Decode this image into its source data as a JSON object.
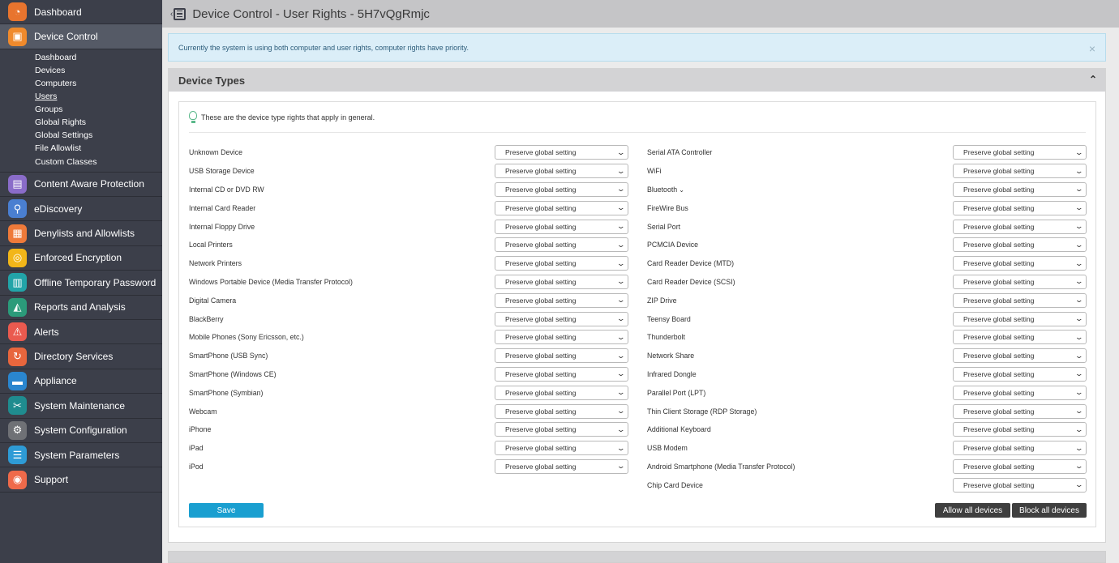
{
  "sidebar": {
    "items": [
      {
        "id": "dashboard",
        "label": "Dashboard",
        "icon": "dashboard-icon",
        "color": "#e8742e",
        "glyph": "◔"
      },
      {
        "id": "device-control",
        "label": "Device Control",
        "icon": "device-control-icon",
        "color": "#f08a2c",
        "glyph": "▣"
      },
      {
        "id": "content-aware",
        "label": "Content Aware Protection",
        "icon": "content-aware-icon",
        "color": "#8a6cc9",
        "glyph": "▤"
      },
      {
        "id": "ediscovery",
        "label": "eDiscovery",
        "icon": "ediscovery-icon",
        "color": "#4a7fd1",
        "glyph": "⚲"
      },
      {
        "id": "denylists",
        "label": "Denylists and Allowlists",
        "icon": "denylists-icon",
        "color": "#ef7a3a",
        "glyph": "▦"
      },
      {
        "id": "encryption",
        "label": "Enforced Encryption",
        "icon": "encryption-icon",
        "color": "#f2b619",
        "glyph": "◎"
      },
      {
        "id": "otp",
        "label": "Offline Temporary Password",
        "icon": "otp-icon",
        "color": "#22a4a8",
        "glyph": "▥"
      },
      {
        "id": "reports",
        "label": "Reports and Analysis",
        "icon": "reports-icon",
        "color": "#2b9b7a",
        "glyph": "◭"
      },
      {
        "id": "alerts",
        "label": "Alerts",
        "icon": "alerts-icon",
        "color": "#ea5a4f",
        "glyph": "⚠"
      },
      {
        "id": "directory",
        "label": "Directory Services",
        "icon": "directory-icon",
        "color": "#e8663d",
        "glyph": "↻"
      },
      {
        "id": "appliance",
        "label": "Appliance",
        "icon": "appliance-icon",
        "color": "#2a86cf",
        "glyph": "▬"
      },
      {
        "id": "maintenance",
        "label": "System Maintenance",
        "icon": "maintenance-icon",
        "color": "#1f8c8f",
        "glyph": "✂"
      },
      {
        "id": "configuration",
        "label": "System Configuration",
        "icon": "configuration-icon",
        "color": "#6f7176",
        "glyph": "⚙"
      },
      {
        "id": "parameters",
        "label": "System Parameters",
        "icon": "parameters-icon",
        "color": "#2e9bd6",
        "glyph": "☰"
      },
      {
        "id": "support",
        "label": "Support",
        "icon": "support-icon",
        "color": "#ef6a4a",
        "glyph": "◉"
      }
    ],
    "submenu": [
      {
        "label": "Dashboard",
        "current": false
      },
      {
        "label": "Devices",
        "current": false
      },
      {
        "label": "Computers",
        "current": false
      },
      {
        "label": "Users",
        "current": true
      },
      {
        "label": "Groups",
        "current": false
      },
      {
        "label": "Global Rights",
        "current": false
      },
      {
        "label": "Global Settings",
        "current": false
      },
      {
        "label": "File Allowlist",
        "current": false
      },
      {
        "label": "Custom Classes",
        "current": false
      }
    ]
  },
  "header": {
    "title": "Device Control - User Rights - 5H7vQgRmjc"
  },
  "alert": {
    "text": "Currently the system is using both computer and user rights, computer rights have priority.",
    "close": "×"
  },
  "panel": {
    "title": "Device Types",
    "toggle": "⌃",
    "hint": "These are the device type rights that apply in general.",
    "select_value": "Preserve global setting",
    "left_devices": [
      "Unknown Device",
      "USB Storage Device",
      "Internal CD or DVD RW",
      "Internal Card Reader",
      "Internal Floppy Drive",
      "Local Printers",
      "Network Printers",
      "Windows Portable Device (Media Transfer Protocol)",
      "Digital Camera",
      "BlackBerry",
      "Mobile Phones (Sony Ericsson, etc.)",
      "SmartPhone (USB Sync)",
      "SmartPhone (Windows CE)",
      "SmartPhone (Symbian)",
      "Webcam",
      "iPhone",
      "iPad",
      "iPod"
    ],
    "right_devices": [
      "Serial ATA Controller",
      "WiFi",
      "Bluetooth",
      "FireWire Bus",
      "Serial Port",
      "PCMCIA Device",
      "Card Reader Device (MTD)",
      "Card Reader Device (SCSI)",
      "ZIP Drive",
      "Teensy Board",
      "Thunderbolt",
      "Network Share",
      "Infrared Dongle",
      "Parallel Port (LPT)",
      "Thin Client Storage (RDP Storage)",
      "Additional Keyboard",
      "USB Modem",
      "Android Smartphone (Media Transfer Protocol)",
      "Chip Card Device"
    ],
    "save_label": "Save",
    "allow_label": "Allow all devices",
    "block_label": "Block all devices"
  }
}
